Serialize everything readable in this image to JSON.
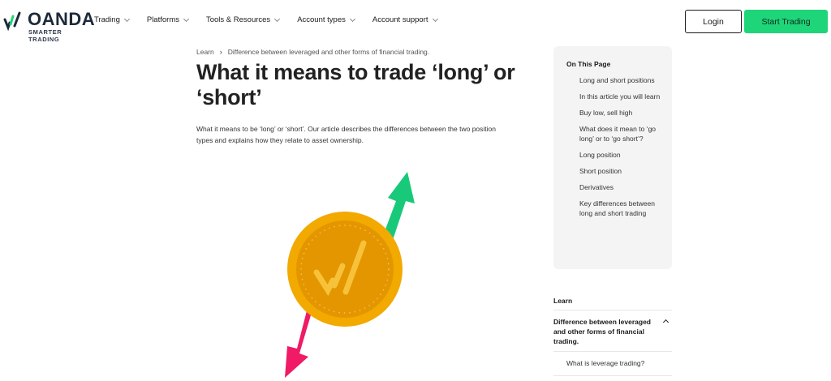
{
  "brand": {
    "name": "OANDA",
    "tagline": "SMARTER TRADING"
  },
  "nav": {
    "items": [
      {
        "label": "Trading"
      },
      {
        "label": "Platforms"
      },
      {
        "label": "Tools & Resources"
      },
      {
        "label": "Account types"
      },
      {
        "label": "Account support"
      }
    ],
    "login_label": "Login",
    "start_label": "Start Trading"
  },
  "breadcrumb": {
    "root": "Learn",
    "separator": "›",
    "current": "Difference between leveraged and other forms of financial trading."
  },
  "article": {
    "title": "What it means to trade ‘long’ or ‘short’",
    "intro": "What it means to be ‘long’ or ‘short’. Our article describes the differences between the two position types and explains how they relate to asset ownership."
  },
  "toc": {
    "title": "On This Page",
    "items": [
      "Long and short positions",
      "In this article you will learn",
      "Buy low, sell high",
      "What does it mean to ‘go long’ or to ‘go short’?",
      "Long position",
      "Short position",
      "Derivatives",
      "Key differences between long and short trading"
    ]
  },
  "learn_nav": {
    "title": "Learn",
    "section": "Difference between leveraged and other forms of financial trading.",
    "sub_item": "What is leverage trading?"
  },
  "colors": {
    "accent_green": "#1fd57a",
    "arrow_green": "#19c97a",
    "arrow_pink": "#f01a66",
    "coin_gold": "#f2a900",
    "coin_dark": "#d98d00",
    "navy": "#1b2a3a"
  }
}
